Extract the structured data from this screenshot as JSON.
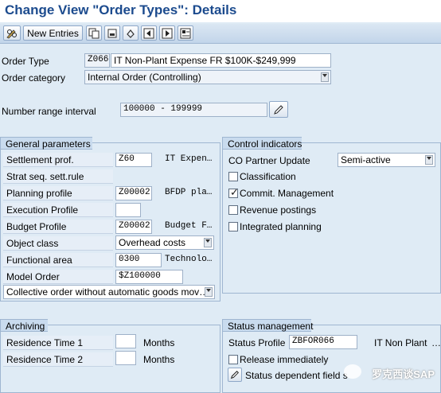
{
  "title": "Change View \"Order Types\": Details",
  "toolbar": {
    "new_entries_label": "New Entries"
  },
  "header": {
    "order_type_label": "Order Type",
    "order_type_code": "Z066",
    "order_type_desc": "IT Non-Plant Expense FR $100K-$249,999",
    "order_category_label": "Order category",
    "order_category_value": "Internal Order (Controlling)",
    "number_range_label": "Number range interval",
    "number_range_value": "100000 - 199999"
  },
  "general_parameters": {
    "title": "General parameters",
    "settlement_prof_label": "Settlement prof.",
    "settlement_prof_value": "Z60",
    "settlement_prof_desc": "IT Expen…",
    "strat_seq_label": "Strat seq. sett.rule",
    "planning_profile_label": "Planning profile",
    "planning_profile_value": "Z00002",
    "planning_profile_desc": "BFDP pla…",
    "execution_profile_label": "Execution Profile",
    "execution_profile_value": "",
    "budget_profile_label": "Budget Profile",
    "budget_profile_value": "Z00002",
    "budget_profile_desc": "Budget F…",
    "object_class_label": "Object class",
    "object_class_value": "Overhead costs",
    "functional_area_label": "Functional area",
    "functional_area_value": "0300",
    "functional_area_desc": "Technolo…",
    "model_order_label": "Model Order",
    "model_order_value": "$Z100000",
    "collective_order_value": "Collective order without automatic goods mov…"
  },
  "control_indicators": {
    "title": "Control indicators",
    "co_partner_label": "CO Partner Update",
    "co_partner_value": "Semi-active",
    "classification_label": "Classification",
    "classification_checked": false,
    "commit_label": "Commit. Management",
    "commit_checked": true,
    "revenue_label": "Revenue postings",
    "revenue_checked": false,
    "integrated_label": "Integrated planning",
    "integrated_checked": false
  },
  "archiving": {
    "title": "Archiving",
    "residence1_label": "Residence Time 1",
    "residence1_value": "",
    "residence1_unit": "Months",
    "residence2_label": "Residence Time 2",
    "residence2_value": "",
    "residence2_unit": "Months"
  },
  "status_management": {
    "title": "Status management",
    "status_profile_label": "Status Profile",
    "status_profile_value": "ZBFOR066",
    "status_profile_desc": "IT Non Plant",
    "release_label": "Release immediately",
    "release_checked": false,
    "status_dependent_label": "Status dependent field s"
  },
  "watermark": "罗克西谈SAP"
}
